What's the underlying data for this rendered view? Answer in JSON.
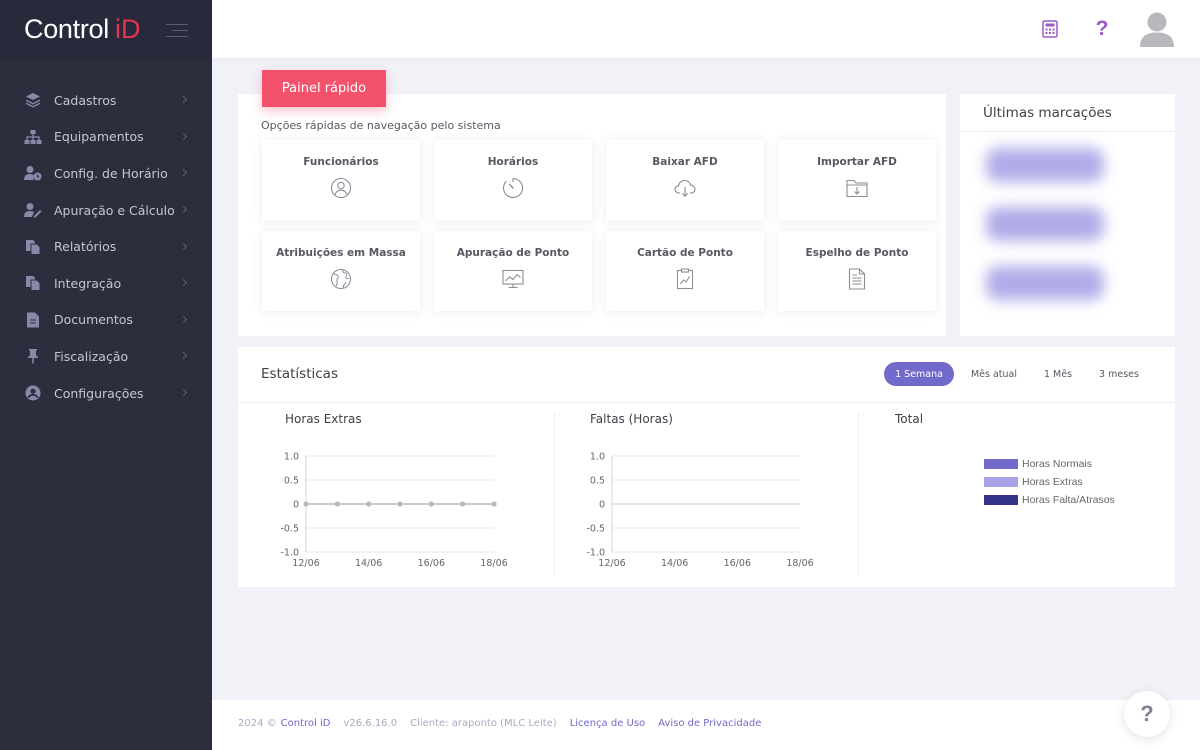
{
  "brand": {
    "name": "Control",
    "accent": "iD",
    "accent_color": "#e8334f"
  },
  "sidebar": {
    "items": [
      {
        "label": "Cadastros",
        "icon": "layers-icon"
      },
      {
        "label": "Equipamentos",
        "icon": "sitemap-icon"
      },
      {
        "label": "Config. de Horário",
        "icon": "user-clock-icon"
      },
      {
        "label": "Apuração e Cálculo",
        "icon": "user-edit-icon"
      },
      {
        "label": "Relatórios",
        "icon": "copy-icon"
      },
      {
        "label": "Integração",
        "icon": "copy-icon"
      },
      {
        "label": "Documentos",
        "icon": "file-icon"
      },
      {
        "label": "Fiscalização",
        "icon": "pin-icon"
      },
      {
        "label": "Configurações",
        "icon": "user-circle-icon"
      }
    ]
  },
  "topbar": {
    "calculator_icon": "calculator-icon",
    "help_label": "?",
    "avatar_icon": "user-avatar-icon"
  },
  "quick_panel": {
    "tab_label": "Painel rápido",
    "subtitle": "Opções rápidas de navegação pelo sistema",
    "tiles": [
      {
        "label": "Funcionários",
        "icon": "user-icon"
      },
      {
        "label": "Horários",
        "icon": "timer-icon"
      },
      {
        "label": "Baixar AFD",
        "icon": "cloud-download-icon"
      },
      {
        "label": "Importar AFD",
        "icon": "folder-download-icon"
      },
      {
        "label": "Atribuições em Massa",
        "icon": "globe-icon"
      },
      {
        "label": "Apuração de Ponto",
        "icon": "monitor-chart-icon"
      },
      {
        "label": "Cartão de Ponto",
        "icon": "document-chart-icon"
      },
      {
        "label": "Espelho de Ponto",
        "icon": "document-lines-icon"
      }
    ]
  },
  "latest_panel": {
    "title": "Últimas marcações"
  },
  "stats": {
    "title": "Estatísticas",
    "periods": [
      {
        "label": "1 Semana",
        "active": true
      },
      {
        "label": "Mês atual",
        "active": false
      },
      {
        "label": "1 Mês",
        "active": false
      },
      {
        "label": "3 meses",
        "active": false
      }
    ],
    "accent": "#716aca"
  },
  "chart_data": [
    {
      "type": "line",
      "title": "Horas Extras",
      "x": [
        "12/06",
        "13/06",
        "14/06",
        "15/06",
        "16/06",
        "17/06",
        "18/06"
      ],
      "x_tick_labels": [
        "12/06",
        "14/06",
        "16/06",
        "18/06"
      ],
      "y_ticks": [
        "1.0",
        "0.5",
        "0",
        "-0.5",
        "-1.0"
      ],
      "ylim": [
        -1.0,
        1.0
      ],
      "series": [
        {
          "values": [
            0,
            0,
            0,
            0,
            0,
            0,
            0
          ]
        }
      ],
      "grid": true
    },
    {
      "type": "line",
      "title": "Faltas (Horas)",
      "x": [
        "12/06",
        "13/06",
        "14/06",
        "15/06",
        "16/06",
        "17/06",
        "18/06"
      ],
      "x_tick_labels": [
        "12/06",
        "14/06",
        "16/06",
        "18/06"
      ],
      "y_ticks": [
        "1.0",
        "0.5",
        "0",
        "-0.5",
        "-1.0"
      ],
      "ylim": [
        -1.0,
        1.0
      ],
      "series": [],
      "grid": true
    },
    {
      "type": "pie",
      "title": "Total",
      "legend_position": "right",
      "series": [
        {
          "name": "Horas Normais",
          "color": "#716aca"
        },
        {
          "name": "Horas Extras",
          "color": "#a7a3e6"
        },
        {
          "name": "Horas Falta/Atrasos",
          "color": "#35328a"
        }
      ]
    }
  ],
  "footer": {
    "copyright": "2024 ©",
    "brand_link": "Control iD",
    "version": "v26.6.16.0",
    "client": "Cliente: araponto (MLC Leite)",
    "license_link": "Licença de Uso",
    "privacy_link": "Aviso de Privacidade"
  },
  "help_fab": {
    "label": "?"
  }
}
